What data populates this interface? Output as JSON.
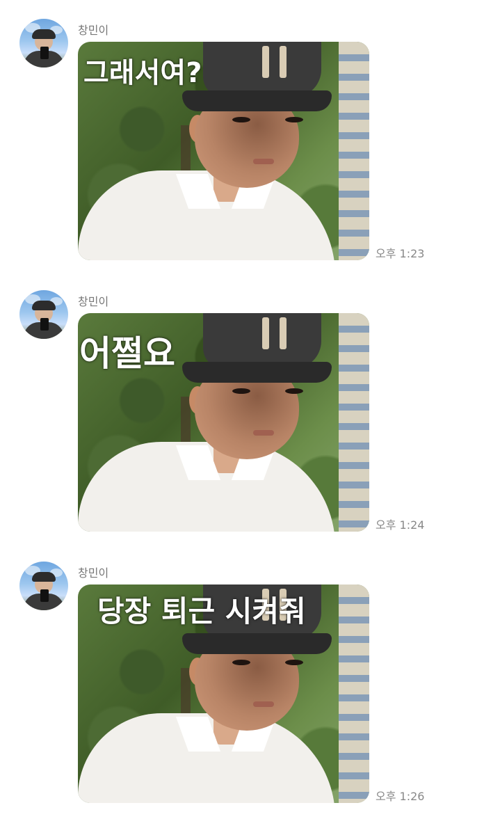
{
  "messages": [
    {
      "sender": "창민이",
      "caption": "그래서여?",
      "time": "오후 1:23"
    },
    {
      "sender": "창민이",
      "caption": "어쩔요",
      "time": "오후 1:24"
    },
    {
      "sender": "창민이",
      "caption": "당장 퇴근 시켜줘",
      "time": "오후 1:26"
    }
  ]
}
